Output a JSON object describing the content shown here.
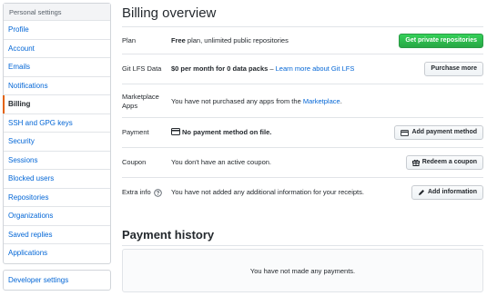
{
  "sidebar": {
    "header": "Personal settings",
    "items": [
      {
        "label": "Profile"
      },
      {
        "label": "Account"
      },
      {
        "label": "Emails"
      },
      {
        "label": "Notifications"
      },
      {
        "label": "Billing"
      },
      {
        "label": "SSH and GPG keys"
      },
      {
        "label": "Security"
      },
      {
        "label": "Sessions"
      },
      {
        "label": "Blocked users"
      },
      {
        "label": "Repositories"
      },
      {
        "label": "Organizations"
      },
      {
        "label": "Saved replies"
      },
      {
        "label": "Applications"
      }
    ],
    "active": "Billing",
    "developer_settings": "Developer settings"
  },
  "billing": {
    "title": "Billing overview",
    "plan": {
      "label": "Plan",
      "value_bold": "Free",
      "value_rest": " plan, unlimited public repositories",
      "button": "Get private repositories"
    },
    "lfs": {
      "label": "Git LFS Data",
      "value_bold": "$0 per month for 0 data packs",
      "separator": " – ",
      "link": "Learn more about Git LFS",
      "button": "Purchase more"
    },
    "marketplace": {
      "label_line1": "Marketplace",
      "label_line2": "Apps",
      "value_text": "You have not purchased any apps from the ",
      "link": "Marketplace",
      "value_end": "."
    },
    "payment": {
      "label": "Payment",
      "value": "No payment method on file.",
      "button": "Add payment method"
    },
    "coupon": {
      "label": "Coupon",
      "value": "You don't have an active coupon.",
      "button": "Redeem a coupon"
    },
    "extra": {
      "label": "Extra info",
      "value": "You have not added any additional information for your receipts.",
      "button": "Add information"
    }
  },
  "history": {
    "title": "Payment history",
    "empty": "You have not made any payments."
  },
  "colors": {
    "link": "#0366d6",
    "active_marker": "#e36209",
    "primary_button": "#28a745"
  }
}
